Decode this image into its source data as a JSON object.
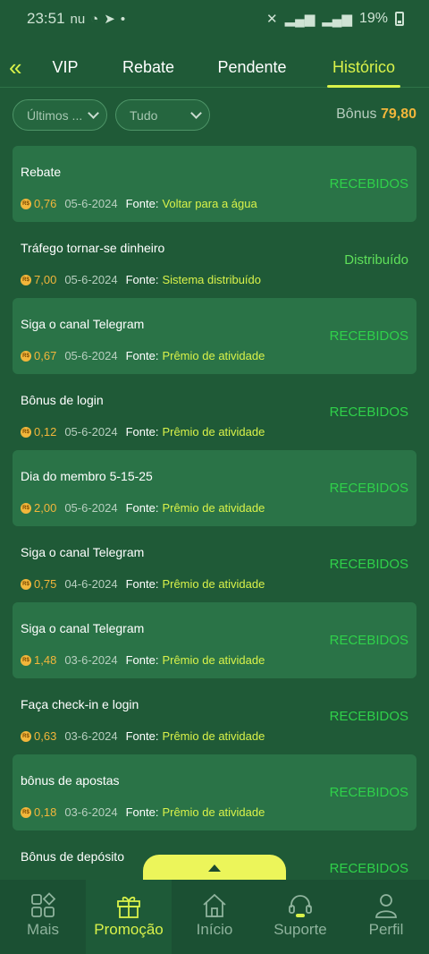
{
  "status_bar": {
    "time": "23:51",
    "left_icons": "nu",
    "battery": "19%"
  },
  "tabs": {
    "back_icon": "double-chevron-left-icon",
    "items": [
      {
        "label": "VIP"
      },
      {
        "label": "Rebate"
      },
      {
        "label": "Pendente"
      },
      {
        "label": "Histórico",
        "active": true
      }
    ]
  },
  "filters": {
    "period": "Últimos ...",
    "type": "Tudo",
    "bonus_label": "Bônus",
    "bonus_value": "79,80"
  },
  "records": [
    {
      "title": "Rebate",
      "amount": "0,76",
      "date": "05-6-2024",
      "fonte_label": "Fonte:",
      "fonte": "Voltar para a água",
      "status": "RECEBIDOS"
    },
    {
      "title": "Tráfego tornar-se dinheiro",
      "amount": "7,00",
      "date": "05-6-2024",
      "fonte_label": "Fonte:",
      "fonte": "Sistema distribuído",
      "status": "Distribuído"
    },
    {
      "title": "Siga o canal Telegram",
      "amount": "0,67",
      "date": "05-6-2024",
      "fonte_label": "Fonte:",
      "fonte": "Prêmio de atividade",
      "status": "RECEBIDOS"
    },
    {
      "title": "Bônus de login",
      "amount": "0,12",
      "date": "05-6-2024",
      "fonte_label": "Fonte:",
      "fonte": "Prêmio de atividade",
      "status": "RECEBIDOS"
    },
    {
      "title": "Dia do membro 5-15-25",
      "amount": "2,00",
      "date": "05-6-2024",
      "fonte_label": "Fonte:",
      "fonte": "Prêmio de atividade",
      "status": "RECEBIDOS"
    },
    {
      "title": "Siga o canal Telegram",
      "amount": "0,75",
      "date": "04-6-2024",
      "fonte_label": "Fonte:",
      "fonte": "Prêmio de atividade",
      "status": "RECEBIDOS"
    },
    {
      "title": "Siga o canal Telegram",
      "amount": "1,48",
      "date": "03-6-2024",
      "fonte_label": "Fonte:",
      "fonte": "Prêmio de atividade",
      "status": "RECEBIDOS"
    },
    {
      "title": "Faça check-in e login",
      "amount": "0,63",
      "date": "03-6-2024",
      "fonte_label": "Fonte:",
      "fonte": "Prêmio de atividade",
      "status": "RECEBIDOS"
    },
    {
      "title": "bônus de apostas",
      "amount": "0,18",
      "date": "03-6-2024",
      "fonte_label": "Fonte:",
      "fonte": "Prêmio de atividade",
      "status": "RECEBIDOS"
    },
    {
      "title": "Bônus de depósito",
      "amount": "",
      "date": "",
      "fonte_label": "",
      "fonte": "",
      "status": "RECEBIDOS"
    }
  ],
  "coin_glyph": "R$",
  "nav": [
    {
      "label": "Mais",
      "icon": "grid-diamond-icon"
    },
    {
      "label": "Promoção",
      "icon": "gift-icon",
      "active": true
    },
    {
      "label": "Início",
      "icon": "home-icon"
    },
    {
      "label": "Suporte",
      "icon": "headset-icon"
    },
    {
      "label": "Perfil",
      "icon": "user-icon"
    }
  ],
  "colors": {
    "background": "#1f5a37",
    "accent": "#d9f24a",
    "status_green": "#2fd14a",
    "amount_gold": "#f2b63b"
  }
}
